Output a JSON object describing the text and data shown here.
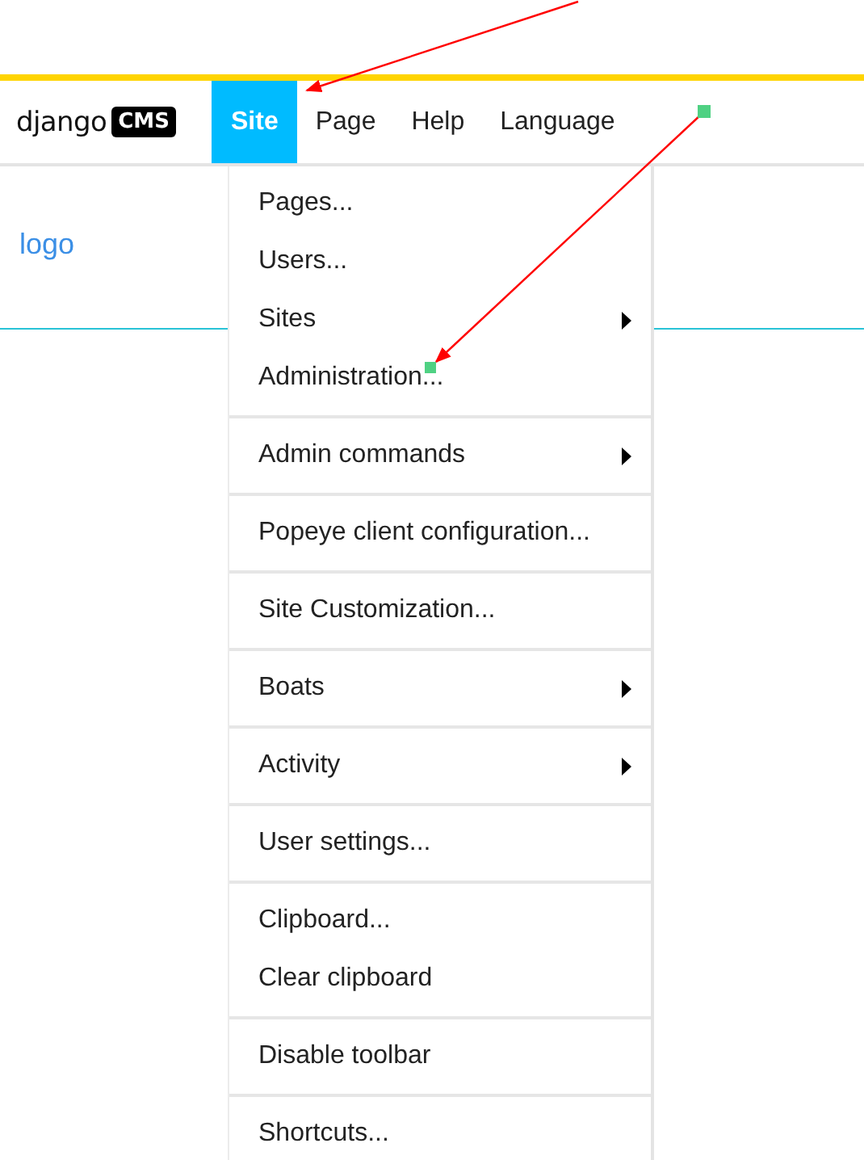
{
  "toolbar": {
    "logo": {
      "text": "django",
      "badge": "CMS"
    },
    "menus": [
      {
        "label": "Site",
        "selected": true
      },
      {
        "label": "Page",
        "selected": false
      },
      {
        "label": "Help",
        "selected": false
      },
      {
        "label": "Language",
        "selected": false
      }
    ]
  },
  "content": {
    "logo_link": "logo"
  },
  "dropdown": {
    "groups": [
      {
        "items": [
          {
            "label": "Pages...",
            "submenu": false
          },
          {
            "label": "Users...",
            "submenu": false
          },
          {
            "label": "Sites",
            "submenu": true
          },
          {
            "label": "Administration...",
            "submenu": false
          }
        ]
      },
      {
        "items": [
          {
            "label": "Admin commands",
            "submenu": true
          }
        ]
      },
      {
        "items": [
          {
            "label": "Popeye client configuration...",
            "submenu": false
          }
        ]
      },
      {
        "items": [
          {
            "label": "Site Customization...",
            "submenu": false
          }
        ]
      },
      {
        "items": [
          {
            "label": "Boats",
            "submenu": true
          }
        ]
      },
      {
        "items": [
          {
            "label": "Activity",
            "submenu": true
          }
        ]
      },
      {
        "items": [
          {
            "label": "User settings...",
            "submenu": false
          }
        ]
      },
      {
        "items": [
          {
            "label": "Clipboard...",
            "submenu": false
          },
          {
            "label": "Clear clipboard",
            "submenu": false
          }
        ]
      },
      {
        "items": [
          {
            "label": "Disable toolbar",
            "submenu": false
          }
        ]
      },
      {
        "items": [
          {
            "label": "Shortcuts...",
            "submenu": false
          }
        ]
      }
    ]
  }
}
